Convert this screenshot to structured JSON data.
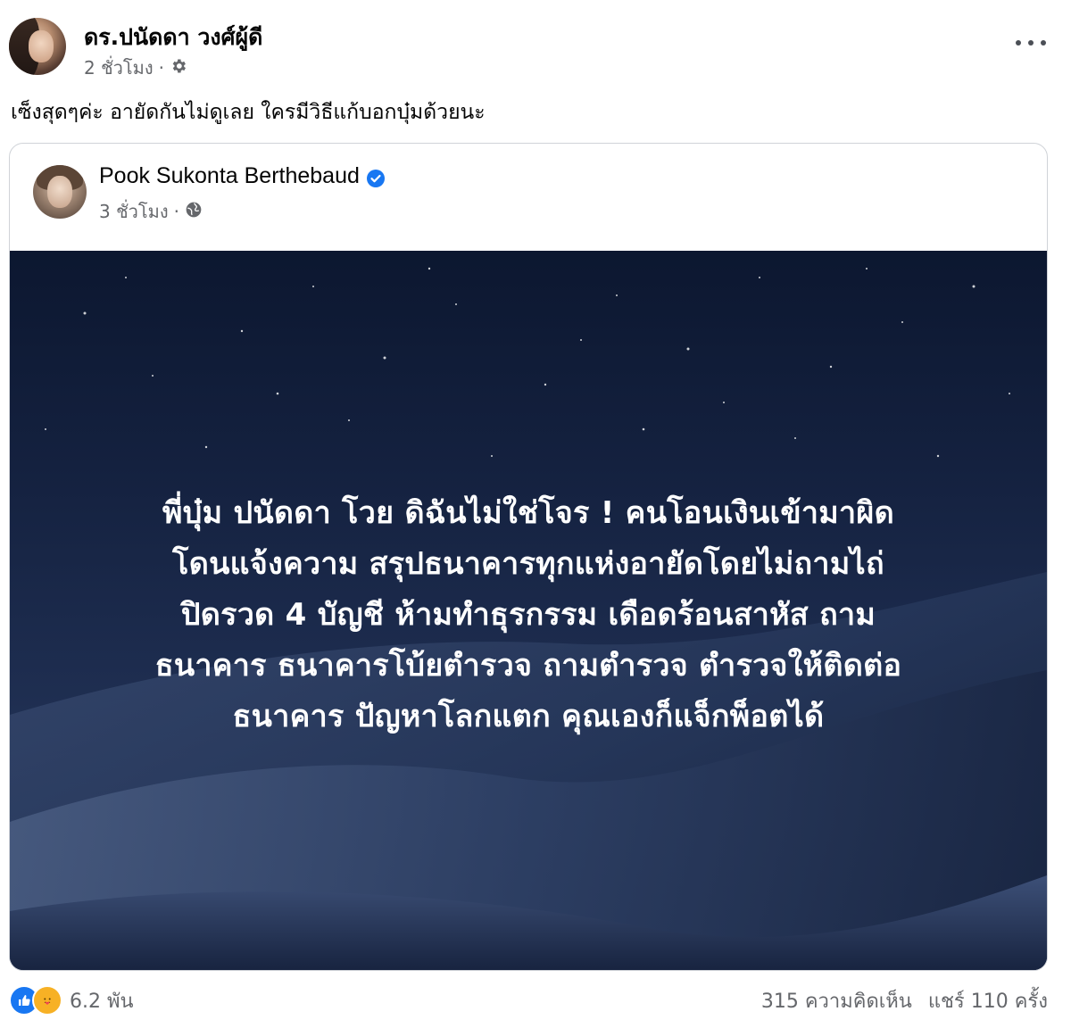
{
  "post": {
    "author": "ดร.ปนัดดา วงศ์ผู้ดี",
    "time": "2 ชั่วโมง",
    "privacy_icon": "gear-icon",
    "caption": "เซ็งสุดๆค่ะ อายัดกันไม่ดูเลย ใครมีวิธีแก้บอกบุ๋มด้วยนะ",
    "more_icon": "more-options-icon"
  },
  "shared": {
    "author": "Pook Sukonta Berthebaud",
    "verified": true,
    "time": "3 ชั่วโมง",
    "privacy_icon": "globe-icon",
    "image_text_lines": [
      "พี่บุ๋ม ปนัดดา โวย ดิฉันไม่ใช่โจร ! คนโอนเงินเข้ามาผิด",
      "โดนแจ้งความ สรุปธนาคารทุกแห่งอายัดโดยไม่ถามไถ่",
      "ปิดรวด 4 บัญชี ห้ามทำธุรกรรม เดือดร้อนสาหัส ถาม",
      "ธนาคาร ธนาคารโบ้ยตำรวจ ถามตำรวจ ตำรวจให้ติดต่อ",
      "ธนาคาร ปัญหาโลกแตก คุณเองก็แจ็กพ็อตได้"
    ]
  },
  "footer": {
    "reaction_count": "6.2 พัน",
    "comments": "315 ความคิดเห็น",
    "shares": "แชร์ 110 ครั้ง"
  },
  "colors": {
    "like_blue": "#1877f2",
    "care_yellow": "#f7b125",
    "secondary_text": "#65676b"
  }
}
